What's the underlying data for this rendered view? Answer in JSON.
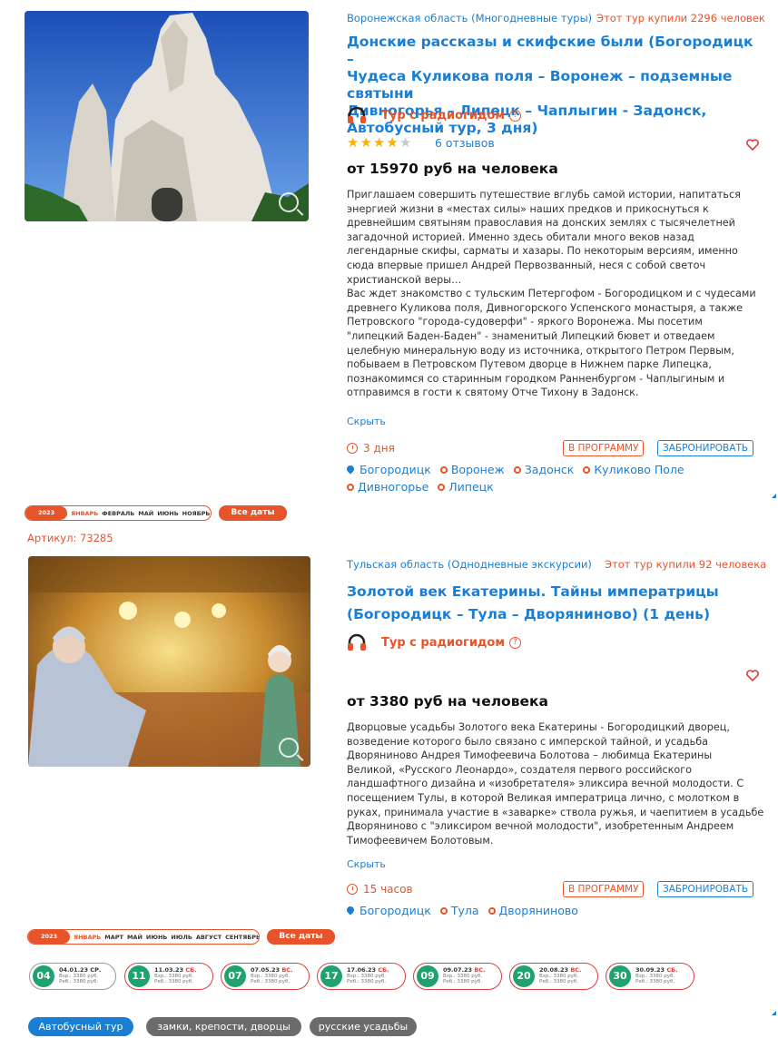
{
  "tours": [
    {
      "region": "Воронежская область (Многодневные туры)",
      "bought": "Этот тур купили 2296 человек",
      "title_lines": [
        "Донские рассказы и скифские были (Богородицк –",
        "Чудеса Куликова поля – Воронеж – подземные святыни",
        "Дивногорья – Липецк – Чаплыгин - Задонск,",
        "Автобусный тур, 3 дня)"
      ],
      "guide": "Тур с радиогидом",
      "rating": 4,
      "reviews": "6 отзывов",
      "price": "от 15970 руб на человека",
      "description_lines": [
        "Приглашаем совершить путешествие вглубь самой истории, напитаться",
        "энергией жизни в «местах силы» наших предков и прикоснуться к",
        "древнейшим святыням православия на донских землях с тысячелетней",
        "загадочной историей. Именно здесь обитали много веков назад",
        "легендарные скифы, сарматы и хазары. По некоторым версиям, именно",
        "сюда впервые пришел Андрей Первозванный, неся с собой светоч",
        "христианской веры…",
        "Вас ждет знакомство с тульским Петергофом - Богородицком и с чудесами",
        "древнего Куликова поля, Дивногорского Успенского монастыря, а также",
        "Петровского \"города-судоверфи\" - яркого Воронежа. Мы посетим",
        "\"липецкий Баден-Баден\" - знаменитый Липецкий бювет и отведаем",
        "целебную минеральную воду из источника, открытого Петром Первым,",
        "побываем в Петровском Путевом дворце в Нижнем парке Липецка,",
        "познакомимся со старинным городком Ранненбургом - Чаплыгиным и",
        "отправимся в гости к святому Отче Тихону в Задонск."
      ],
      "hide_label": "Скрыть",
      "duration": "3 дня",
      "program_label": "В ПРОГРАММУ",
      "book_label": "ЗАБРОНИРОВАТЬ",
      "route_start": "Богородицк",
      "route_line1": [
        "Воронеж",
        "Задонск",
        "Куликово Поле"
      ],
      "route_line2": [
        "Дивногорье",
        "Липецк"
      ],
      "months": {
        "year": "2023",
        "items": [
          "ЯНВАРЬ",
          "ФЕВРАЛЬ",
          "МАЙ",
          "ИЮНЬ",
          "НОЯБРЬ"
        ]
      },
      "all_dates": "Все даты"
    },
    {
      "article": "Артикул: 73285",
      "region": "Тульская область (Однодневные экскурсии)",
      "bought": "Этот тур купили 92 человека",
      "title_lines": [
        "Золотой век Екатерины. Тайны императрицы",
        "(Богородицк – Тула – Дворяниново) (1 день)"
      ],
      "guide": "Тур с радиогидом",
      "price": "от 3380 руб на человека",
      "description_lines": [
        "Дворцовые усадьбы Золотого века Екатерины - Богородицкий дворец,",
        "возведение которого было связано с имперской тайной, и усадьба",
        "Дворяниново Андрея Тимофеевича Болотова – любимца Екатерины",
        "Великой, «Русского Леонардо», создателя первого российского",
        "ландшафтного дизайна и «изобретателя» эликсира вечной молодости. С",
        "посещением Тулы, в которой Великая императрица лично, с молотком в",
        "руках, принимала участие в «заварке» ствола ружья, и чаепитием в усадьбе",
        "Дворяниново с \"эликсиром вечной молодости\", изобретенным Андреем",
        "Тимофеевичем Болотовым."
      ],
      "hide_label": "Скрыть",
      "duration": "15 часов",
      "program_label": "В ПРОГРАММУ",
      "book_label": "ЗАБРОНИРОВАТЬ",
      "route_start": "Богородицк",
      "route_line1": [
        "Тула",
        "Дворяниново"
      ],
      "months": {
        "year": "2023",
        "items": [
          "ЯНВАРЬ",
          "МАРТ",
          "МАЙ",
          "ИЮНЬ",
          "ИЮЛЬ",
          "АВГУСТ",
          "СЕНТЯБРЬ"
        ]
      },
      "all_dates": "Все даты",
      "dates": [
        {
          "day": "04",
          "date": "04.01.23",
          "wd": "СР.",
          "adult": "Взр.: 3380 руб.",
          "child": "Реб.: 3380 руб."
        },
        {
          "day": "11",
          "date": "11.03.23",
          "wd": "СБ.",
          "adult": "Взр.: 3380 руб.",
          "child": "Реб.: 3380 руб."
        },
        {
          "day": "07",
          "date": "07.05.23",
          "wd": "ВС.",
          "adult": "Взр.: 3380 руб.",
          "child": "Реб.: 3380 руб."
        },
        {
          "day": "17",
          "date": "17.06.23",
          "wd": "СБ.",
          "adult": "Взр.: 3380 руб.",
          "child": "Реб.: 3380 руб."
        },
        {
          "day": "09",
          "date": "09.07.23",
          "wd": "ВС.",
          "adult": "Взр.: 3380 руб.",
          "child": "Реб.: 3380 руб."
        },
        {
          "day": "20",
          "date": "20.08.23",
          "wd": "ВС.",
          "adult": "Взр.: 3380 руб.",
          "child": "Реб.: 3380 руб."
        },
        {
          "day": "30",
          "date": "30.09.23",
          "wd": "СБ.",
          "adult": "Взр.: 3380 руб.",
          "child": "Реб.: 3380 руб."
        }
      ],
      "tags": [
        "Автобусный тур",
        "замки, крепости, дворцы",
        "русские усадьбы"
      ]
    }
  ],
  "colors": {
    "blue": "#1a7fd4",
    "orange": "#e8542a",
    "green": "#20a26f",
    "red": "#e23c3c"
  }
}
